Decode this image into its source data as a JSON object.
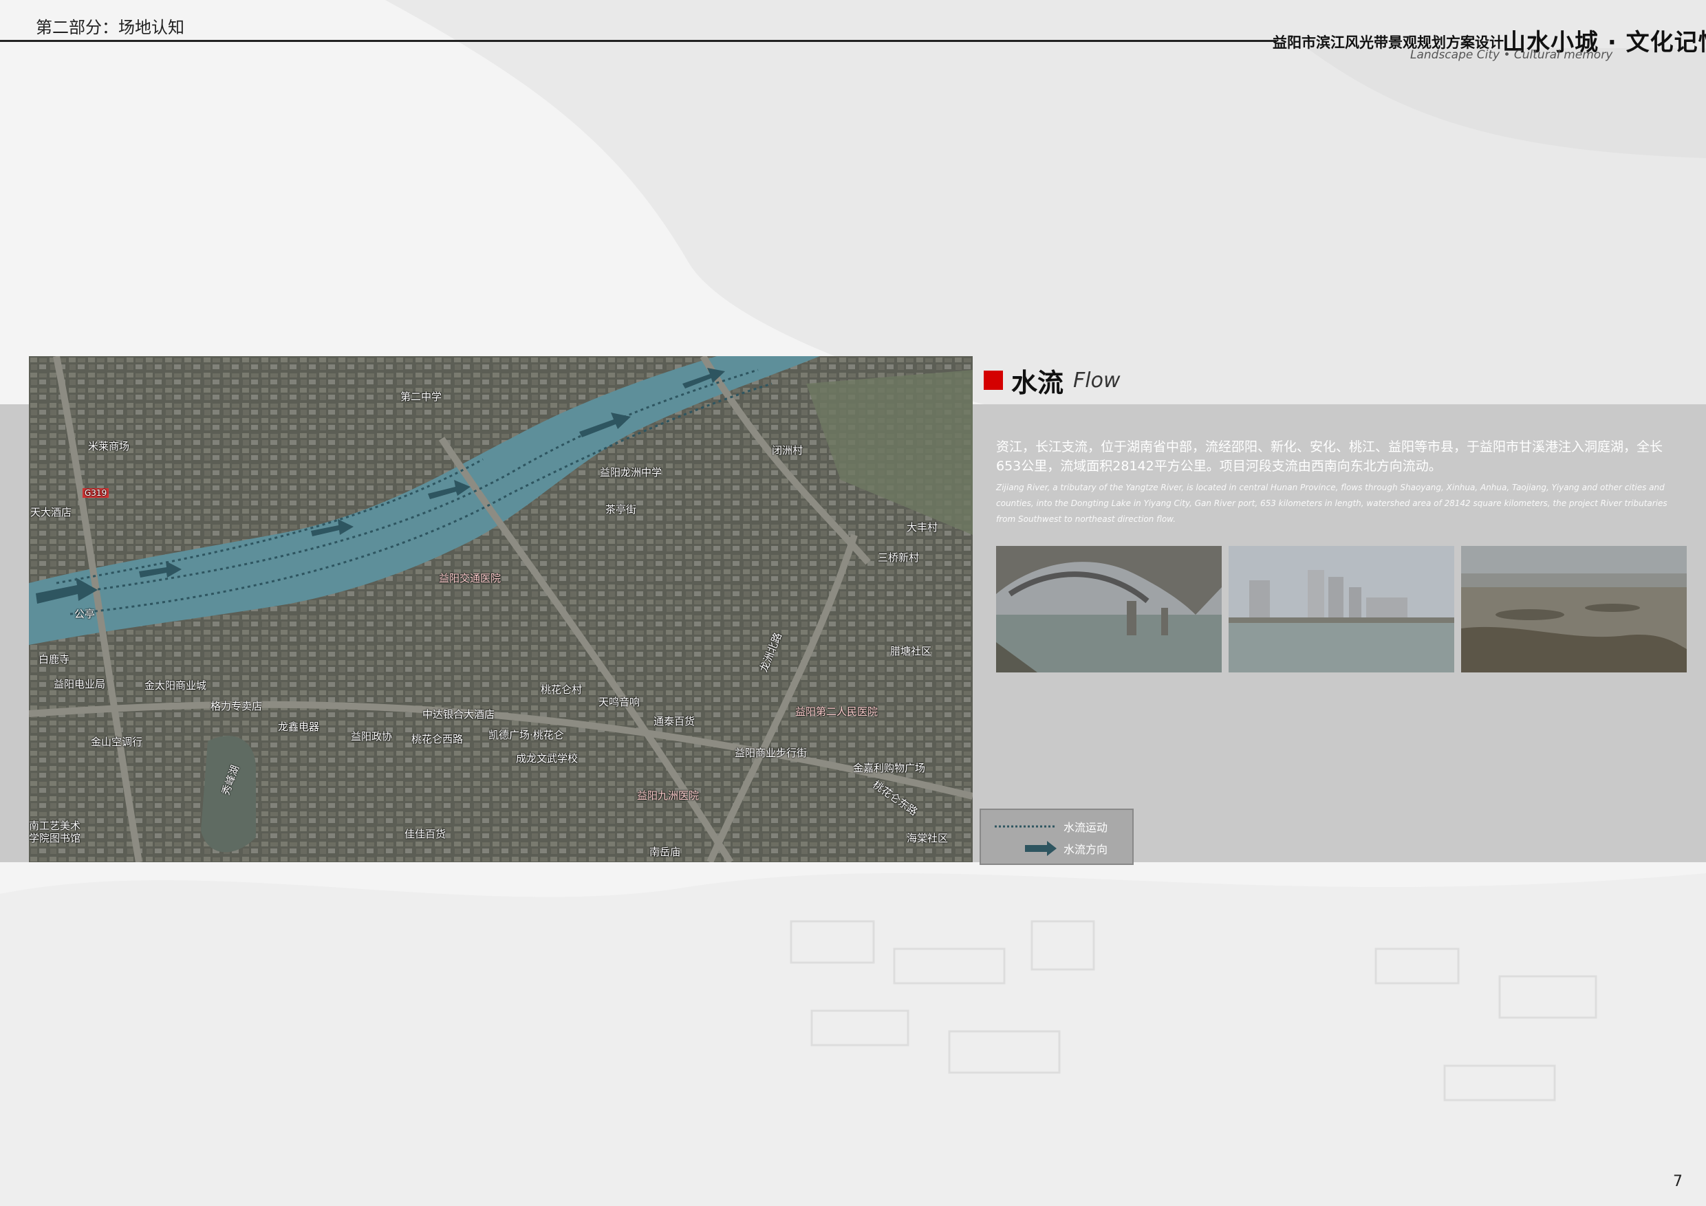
{
  "header": {
    "section": "第二部分：场地认知",
    "project_title": "益阳市滨江风光带景观规划方案设计",
    "brand_cn": "山水小城 · 文化记忆",
    "brand_en": "Landscape City • Cultural memory"
  },
  "map": {
    "labels": [
      {
        "text": "第二中学",
        "kind": "white"
      },
      {
        "text": "米莱商场",
        "kind": "white"
      },
      {
        "text": "天大酒店",
        "kind": "white"
      },
      {
        "text": "益阳龙洲中学",
        "kind": "white"
      },
      {
        "text": "闭洲村",
        "kind": "white"
      },
      {
        "text": "茶亭街",
        "kind": "white"
      },
      {
        "text": "大丰村",
        "kind": "white"
      },
      {
        "text": "三桥新村",
        "kind": "white"
      },
      {
        "text": "益阳交通医院",
        "kind": "red"
      },
      {
        "text": "公亭",
        "kind": "white"
      },
      {
        "text": "白鹿寺",
        "kind": "white"
      },
      {
        "text": "益阳电业局",
        "kind": "white"
      },
      {
        "text": "金太阳商业城",
        "kind": "white"
      },
      {
        "text": "腊塘社区",
        "kind": "white"
      },
      {
        "text": "桃花仑村",
        "kind": "white"
      },
      {
        "text": "格力专卖店",
        "kind": "white"
      },
      {
        "text": "中达银合大酒店",
        "kind": "white"
      },
      {
        "text": "天鸣音响",
        "kind": "white"
      },
      {
        "text": "益阳第二人民医院",
        "kind": "red"
      },
      {
        "text": "龙鑫电器",
        "kind": "white"
      },
      {
        "text": "益阳政协",
        "kind": "white"
      },
      {
        "text": "桃花仑西路",
        "kind": "white"
      },
      {
        "text": "凯德广场·桃花仑",
        "kind": "white"
      },
      {
        "text": "通泰百货",
        "kind": "white"
      },
      {
        "text": "金山空调行",
        "kind": "white"
      },
      {
        "text": "成龙文武学校",
        "kind": "white"
      },
      {
        "text": "益阳商业步行街",
        "kind": "white"
      },
      {
        "text": "金嘉利购物广场",
        "kind": "white"
      },
      {
        "text": "益阳九洲医院",
        "kind": "red"
      },
      {
        "text": "南工艺美术",
        "kind": "white"
      },
      {
        "text": "学院图书馆",
        "kind": "white"
      },
      {
        "text": "佳佳百货",
        "kind": "white"
      },
      {
        "text": "南岳庙",
        "kind": "white"
      },
      {
        "text": "海棠社区",
        "kind": "white"
      },
      {
        "text": "秀峰湖",
        "kind": "white"
      },
      {
        "text": "龙洲北路",
        "kind": "white"
      },
      {
        "text": "桃花仑东路",
        "kind": "white"
      },
      {
        "text": "G319",
        "kind": "white"
      }
    ]
  },
  "flow": {
    "title_cn": "水流",
    "title_en": "Flow",
    "desc_cn": "资江，长江支流，位于湖南省中部，流经邵阳、新化、安化、桃江、益阳等市县，于益阳市甘溪港注入洞庭湖，全长653公里，流域面积28142平方公里。项目河段支流由西南向东北方向流动。",
    "desc_en": "Zijiang River, a tributary of the Yangtze River, is located in central Hunan Province, flows through Shaoyang, Xinhua, Anhua, Taojiang, Yiyang and other cities and counties, into the Dongting Lake in Yiyang City, Gan River port, 653 kilometers in length, watershed area of 28142 square kilometers, the project River tributaries from Southwest to northeast direction flow."
  },
  "photos": [
    {
      "name": "bridge-photo"
    },
    {
      "name": "riverside-buildings-photo"
    },
    {
      "name": "river-shoal-photo"
    }
  ],
  "legend": {
    "motion_label": "水流运动",
    "direction_label": "水流方向"
  },
  "colors": {
    "river": "#5e8f9a",
    "accent_red": "#d40000",
    "band_grey": "#c9c9c9"
  },
  "page_number": "7"
}
